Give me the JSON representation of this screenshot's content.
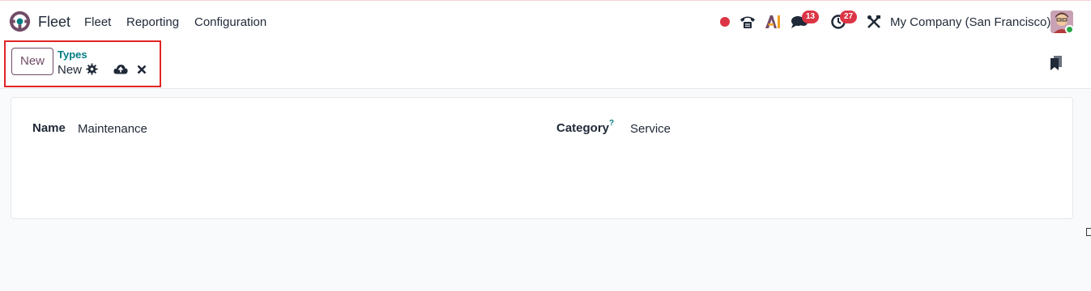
{
  "navbar": {
    "app_name": "Fleet",
    "menu": [
      "Fleet",
      "Reporting",
      "Configuration"
    ],
    "chat_count": "13",
    "activity_count": "27",
    "company": "My Company (San Francisco)",
    "icons": [
      "fleet-logo-icon",
      "recording-dot-icon",
      "phone-icon",
      "ai-icon",
      "chat-icon",
      "activity-clock-icon",
      "debug-tools-icon",
      "user-avatar"
    ]
  },
  "control": {
    "new_label": "New",
    "breadcrumb_parent": "Types",
    "breadcrumb_current": "New",
    "icons": [
      "gear-icon",
      "cloud-save-icon",
      "discard-icon",
      "bookmark-icon"
    ]
  },
  "form": {
    "name_label": "Name",
    "name_value": "Maintenance",
    "category_label": "Category",
    "category_help": "?",
    "category_value": "Service"
  },
  "colors": {
    "brand": "#714b67",
    "link": "#017e84",
    "badge": "#dc3545",
    "highlight": "#e02424"
  }
}
